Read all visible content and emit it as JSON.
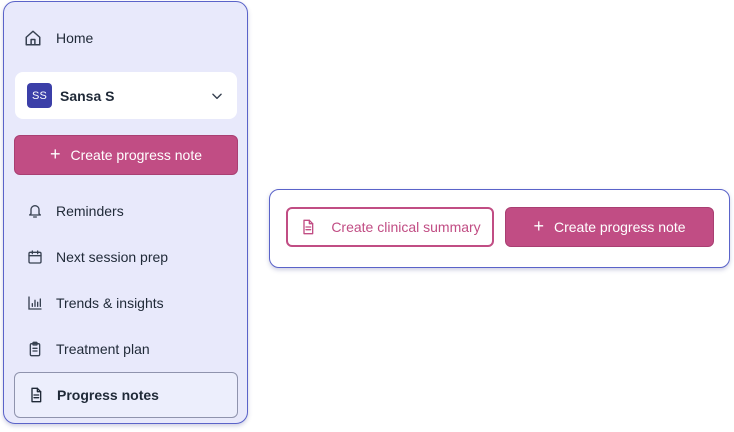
{
  "sidebar": {
    "home_label": "Home",
    "client": {
      "initials": "SS",
      "name": "Sansa S"
    },
    "create_button_label": "Create progress note",
    "items": [
      {
        "label": "Reminders",
        "icon": "bell-icon"
      },
      {
        "label": "Next session prep",
        "icon": "calendar-icon"
      },
      {
        "label": "Trends & insights",
        "icon": "bar-chart-icon"
      },
      {
        "label": "Treatment plan",
        "icon": "clipboard-icon"
      },
      {
        "label": "Progress notes",
        "icon": "document-icon",
        "active": true
      }
    ]
  },
  "actions": {
    "clinical_summary_label": "Create clinical summary",
    "progress_note_label": "Create progress note"
  },
  "colors": {
    "sidebar_bg": "#e8e9fb",
    "accent": "#c14d84",
    "border": "#5a63c9",
    "avatar_bg": "#3b3fa8"
  }
}
